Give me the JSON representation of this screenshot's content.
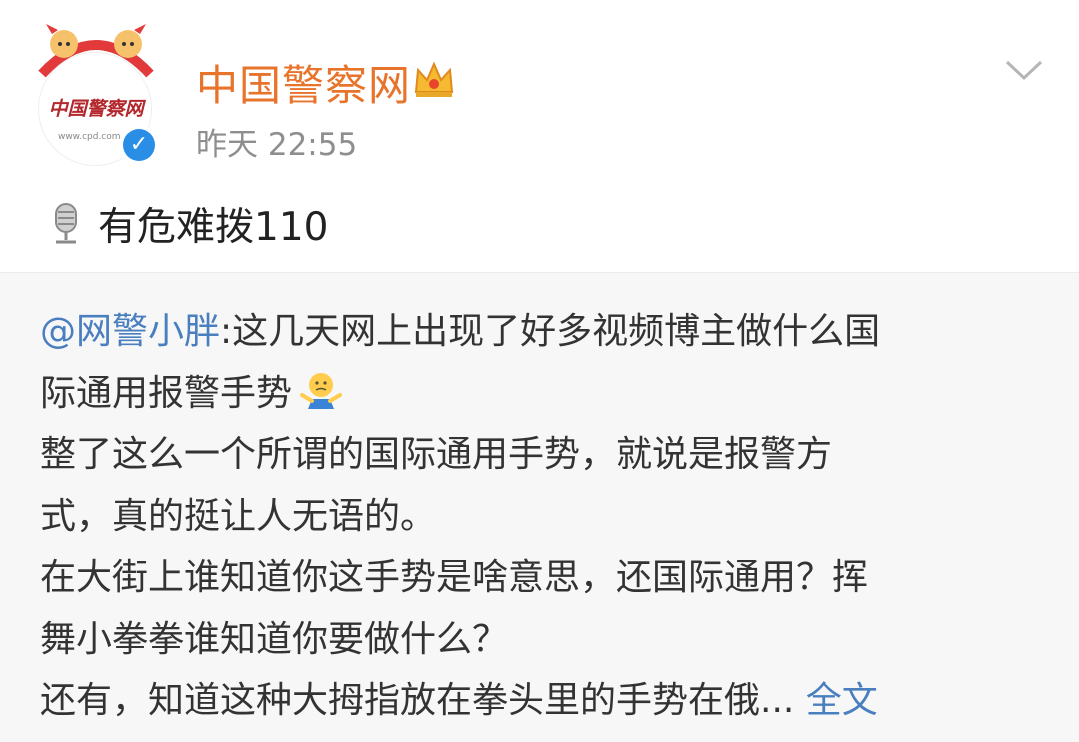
{
  "post": {
    "author": "中国警察网",
    "avatar_text": "中国警察网",
    "avatar_url_text": "www.cpd.com.cn",
    "timestamp": "昨天 22:55",
    "text": "有危难拨110"
  },
  "repost": {
    "mention": "@网警小胖",
    "line1_rest": ":这几天网上出现了好多视频博主做什么国",
    "line2": "际通用报警手势",
    "line3": "整了这么一个所谓的国际通用手势，就说是报警方",
    "line4": "式，真的挺让人无语的。",
    "line5": "在大街上谁知道你这手势是啥意思，还国际通用？挥",
    "line6": "舞小拳拳谁知道你要做什么？",
    "line7": "还有，知道这种大拇指放在拳头里的手势在俄...",
    "expand_label": "全文"
  },
  "icons": {
    "crown": "crown-icon",
    "verified": "verified-icon",
    "menu": "chevron-down-icon",
    "microphone": "microphone-icon",
    "shrug": "shrug-emoji-icon"
  },
  "colors": {
    "username": "#e8732a",
    "link": "#4a7fbf",
    "verified": "#2a8ee6"
  }
}
